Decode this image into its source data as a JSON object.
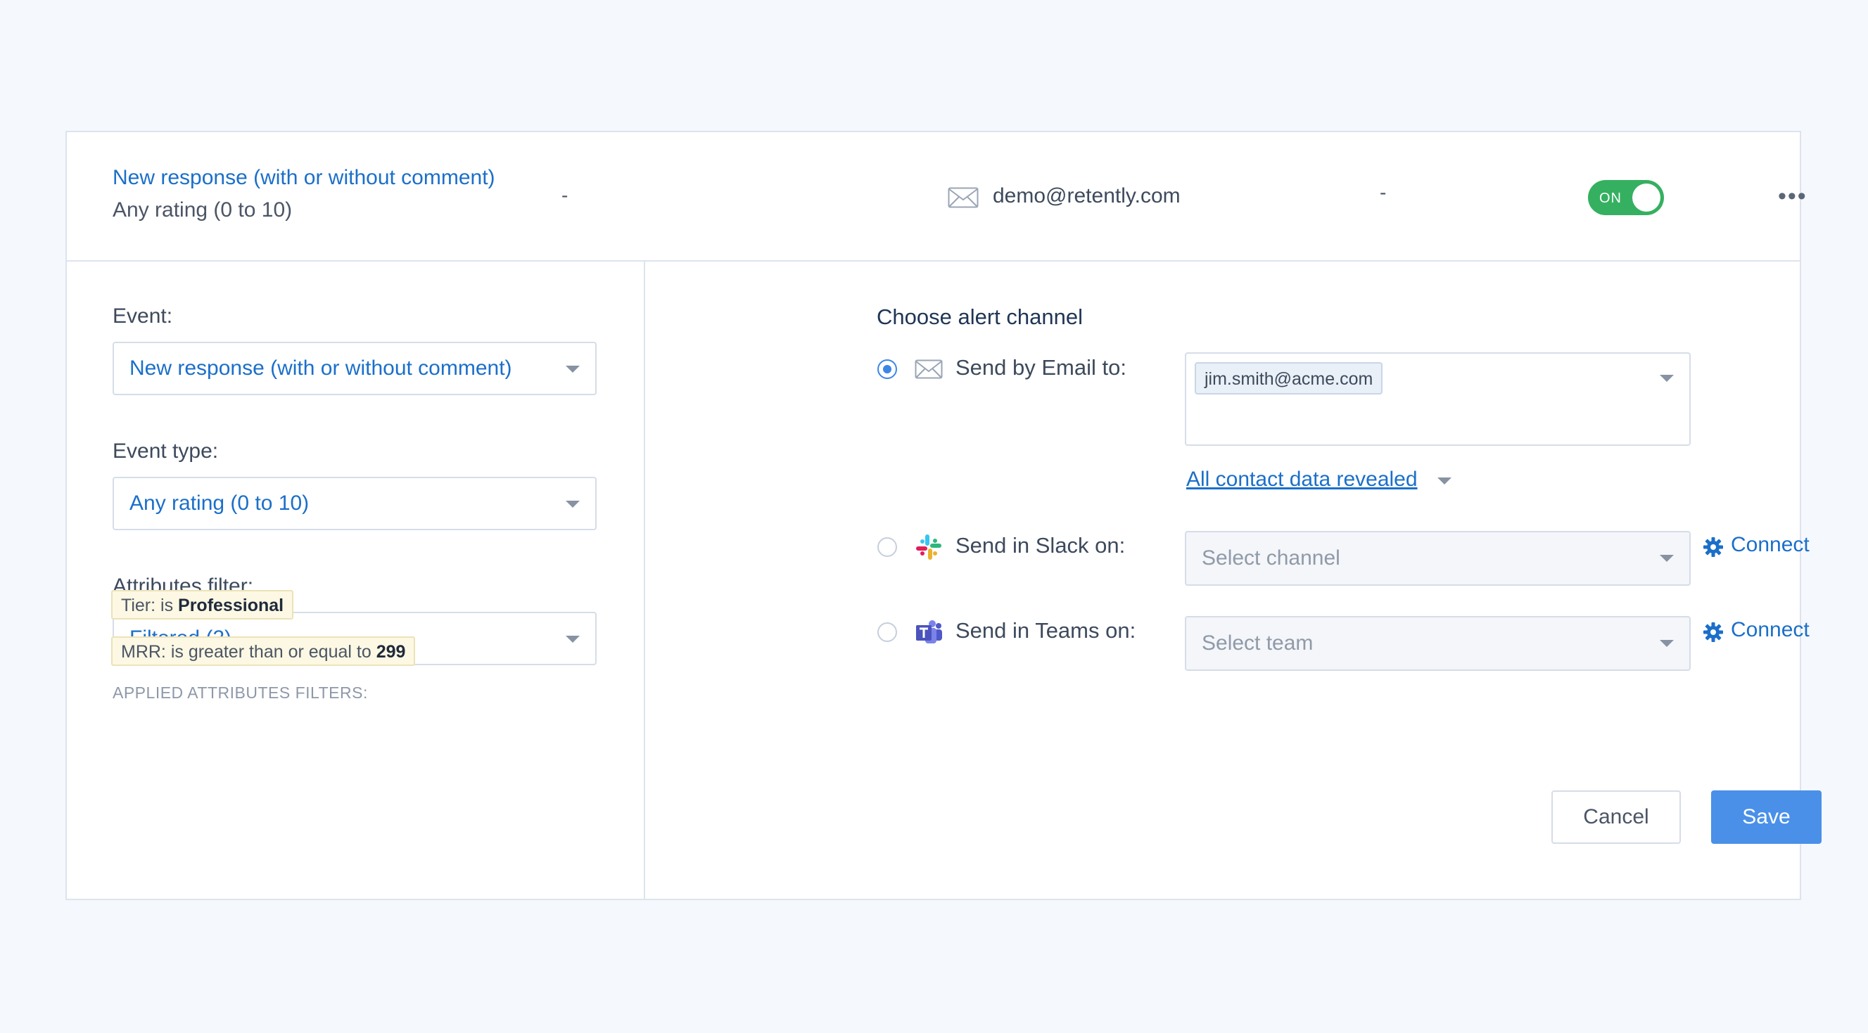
{
  "header": {
    "event_title": "New response (with or without comment)",
    "event_subtitle": "Any rating (0 to 10)",
    "dash_left": "-",
    "email": "demo@retently.com",
    "dash_right": "-",
    "toggle_label": "ON",
    "toggle_on": true,
    "more_label": "•••"
  },
  "left": {
    "event_label": "Event:",
    "event_value": "New response (with or without comment)",
    "event_type_label": "Event type:",
    "event_type_value": "Any rating (0 to 10)",
    "attributes_label": "Attributes filter:",
    "attributes_value": "Filtered (2)",
    "applied_title": "APPLIED ATTRIBUTES FILTERS:",
    "filters": [
      {
        "prefix": "Tier: is",
        "value": "Professional"
      },
      {
        "prefix": "MRR: is greater than or equal to",
        "value": "299"
      }
    ]
  },
  "right": {
    "title": "Choose alert channel",
    "email_channel": {
      "label": "Send by Email to:",
      "tag": "jim.smith@acme.com",
      "selected": true
    },
    "reveal_link": "All contact data revealed",
    "slack_channel": {
      "label": "Send in Slack on:",
      "placeholder": "Select channel",
      "connect": "Connect"
    },
    "teams_channel": {
      "label": "Send in Teams on:",
      "placeholder": "Select team",
      "connect": "Connect"
    },
    "cancel_label": "Cancel",
    "save_label": "Save"
  },
  "colors": {
    "accent": "#1b6fc9",
    "toggle_on": "#35b060",
    "save_button": "#4a90e8",
    "chip_bg": "#fcf8e3"
  }
}
